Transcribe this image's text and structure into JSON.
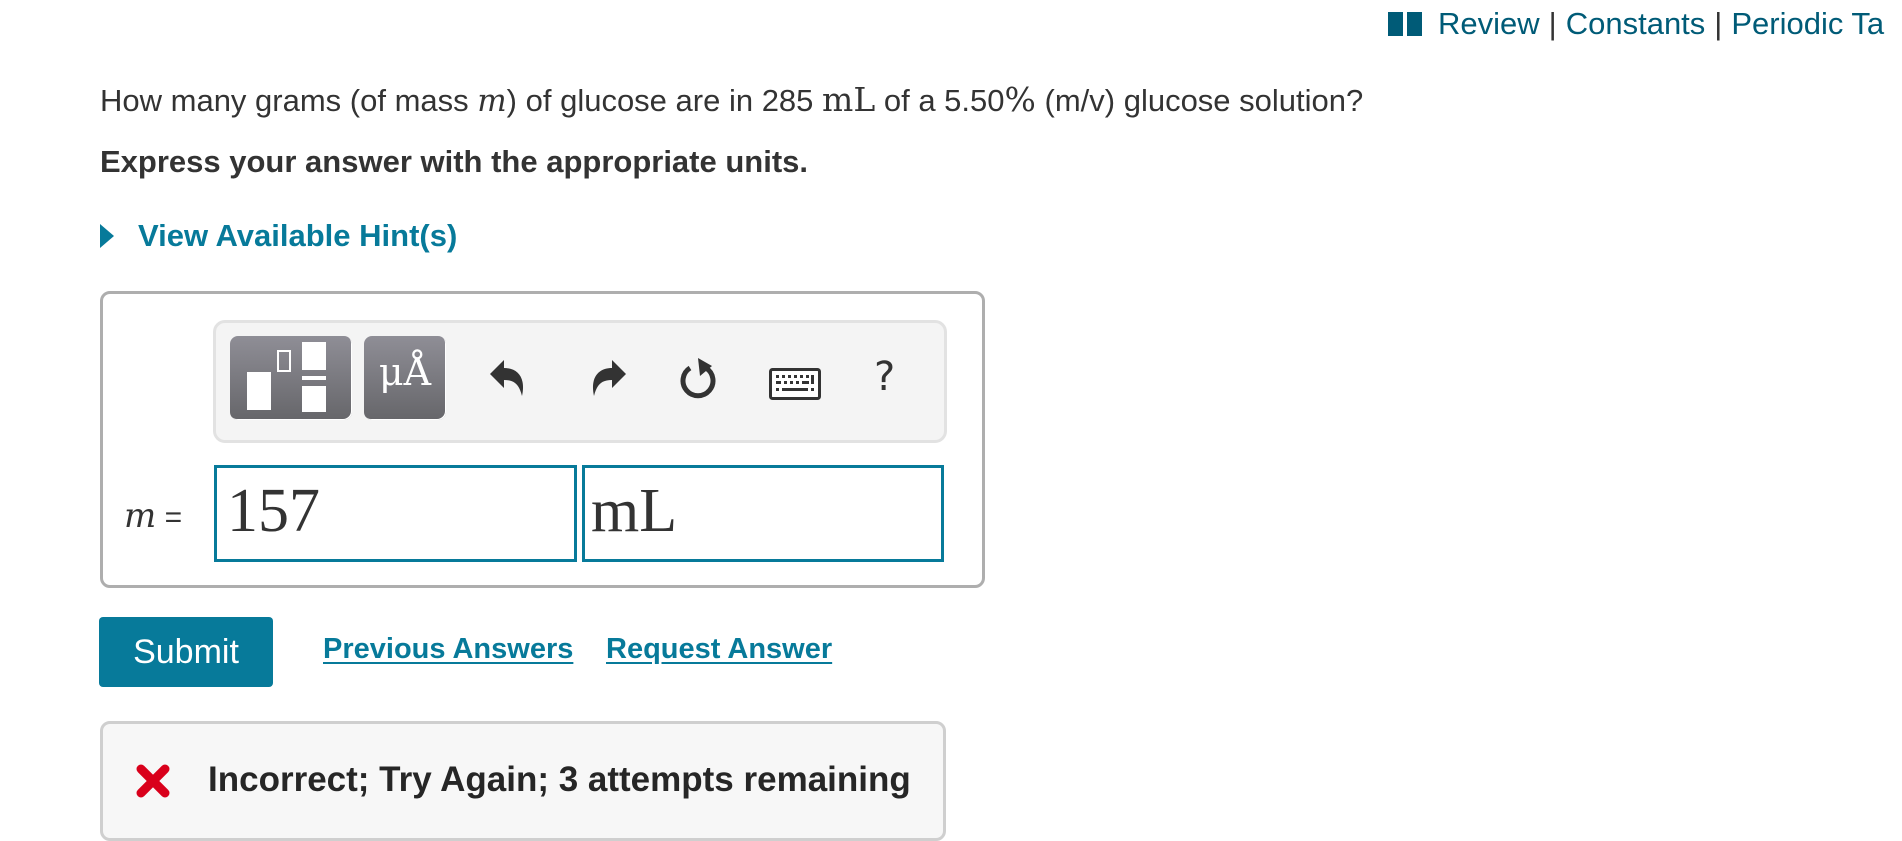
{
  "top_links": {
    "icon": "book-icon",
    "items": [
      "Review",
      "Constants",
      "Periodic Ta"
    ],
    "separator": "|"
  },
  "question": {
    "part1": "How many grams (of mass ",
    "var": "m",
    "part2": ") of glucose are in 285 ",
    "unit": "mL",
    "part3": " of a 5.50",
    "percent": "%",
    "part4": " (m/v) glucose solution?"
  },
  "instruction": "Express your answer with the appropriate units.",
  "hint": {
    "label": "View Available Hint(s)",
    "icon": "triangle-right-icon"
  },
  "toolbar": {
    "template_button": "templates-icon",
    "units_button_label": "μÅ",
    "undo": "undo-icon",
    "redo": "redo-icon",
    "reset": "reset-icon",
    "keyboard": "keyboard-icon",
    "help_label": "?"
  },
  "answer": {
    "variable": "m",
    "equals": "=",
    "value": "157",
    "unit": "mL"
  },
  "actions": {
    "submit_label": "Submit",
    "previous_answers_label": "Previous Answers",
    "request_answer_label": "Request Answer"
  },
  "feedback": {
    "icon": "x-icon",
    "message": "Incorrect; Try Again; 3 attempts remaining",
    "color": "#d9001b"
  },
  "colors": {
    "accent": "#077a9a",
    "link_dark": "#005b77",
    "text": "#333333"
  }
}
